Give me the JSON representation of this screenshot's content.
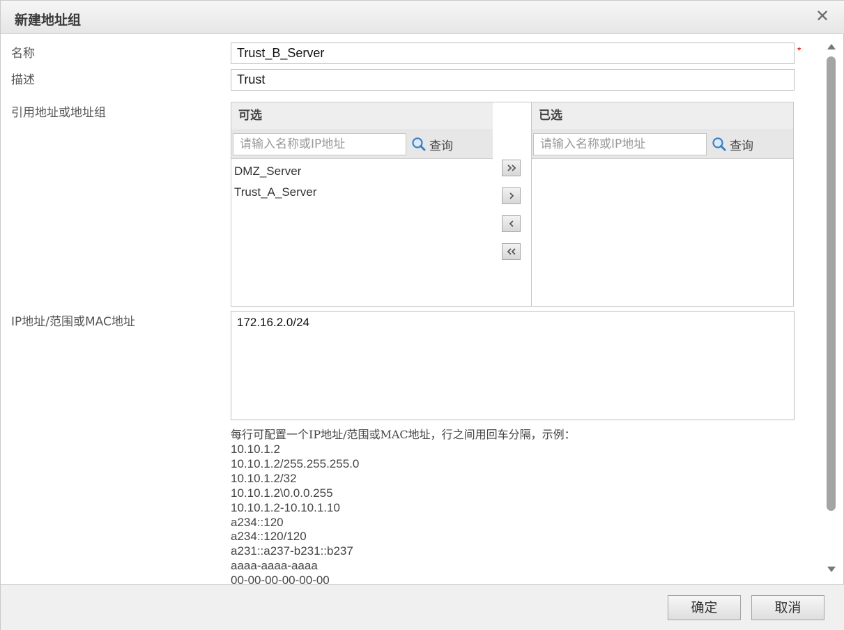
{
  "dialog": {
    "title": "新建地址组",
    "close_label": "✕"
  },
  "form": {
    "name_label": "名称",
    "name_value": "Trust_B_Server",
    "required_mark": "*",
    "desc_label": "描述",
    "desc_value": "Trust",
    "ref_label": "引用地址或地址组",
    "ip_label": "IP地址/范围或MAC地址",
    "ip_value": "172.16.2.0/24"
  },
  "transfer": {
    "available": {
      "title": "可选",
      "search_placeholder": "请输入名称或IP地址",
      "search_label": "查询",
      "items": [
        "DMZ_Server",
        "Trust_A_Server"
      ]
    },
    "selected": {
      "title": "已选",
      "search_placeholder": "请输入名称或IP地址",
      "search_label": "查询",
      "items": []
    },
    "buttons": [
      "move-all-right",
      "move-right",
      "move-left",
      "move-all-left"
    ]
  },
  "hint": {
    "title": "每行可配置一个IP地址/范围或MAC地址，行之间用回车分隔，示例：",
    "examples": [
      "10.10.1.2",
      "10.10.1.2/255.255.255.0",
      "10.10.1.2/32",
      "10.10.1.2\\0.0.0.255",
      "10.10.1.2-10.10.1.10",
      "a234::120",
      "a234::120/120",
      "a231::a237-b231::b237",
      "aaaa-aaaa-aaaa",
      "00-00-00-00-00-00"
    ]
  },
  "footer": {
    "ok_label": "确定",
    "cancel_label": "取消"
  }
}
